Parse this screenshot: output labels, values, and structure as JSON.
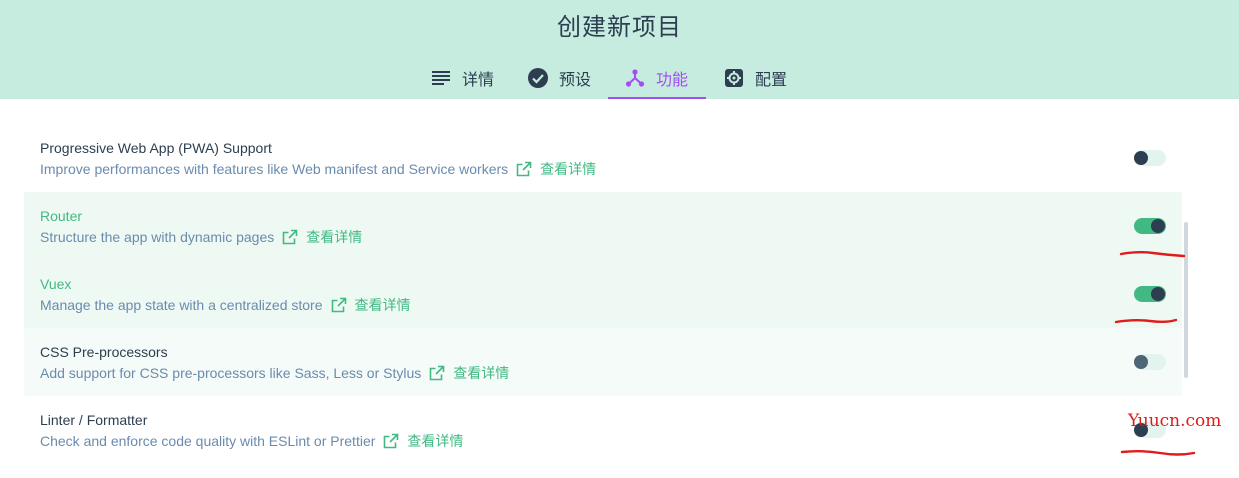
{
  "header": {
    "title": "创建新项目",
    "tabs": [
      {
        "label": "详情",
        "icon": "list-icon"
      },
      {
        "label": "预设",
        "icon": "check-circle-icon"
      },
      {
        "label": "功能",
        "icon": "fork-icon",
        "active": true
      },
      {
        "label": "配置",
        "icon": "gear-icon"
      }
    ]
  },
  "features": [
    {
      "name": "Progressive Web App (PWA) Support",
      "description": "Improve performances with features like Web manifest and Service workers",
      "more": "查看详情",
      "enabled": false
    },
    {
      "name": "Router",
      "description": "Structure the app with dynamic pages",
      "more": "查看详情",
      "enabled": true
    },
    {
      "name": "Vuex",
      "description": "Manage the app state with a centralized store",
      "more": "查看详情",
      "enabled": true
    },
    {
      "name": "CSS Pre-processors",
      "description": "Add support for CSS pre-processors like Sass, Less or Stylus",
      "more": "查看详情",
      "enabled": false
    },
    {
      "name": "Linter / Formatter",
      "description": "Check and enforce code quality with ESLint or Prettier",
      "more": "查看详情",
      "enabled": false
    }
  ],
  "watermark": "Yuucn.com",
  "colors": {
    "header_bg": "#c6ebdf",
    "accent_green": "#42b983",
    "accent_purple": "#a44cf6",
    "text": "#2c3e50",
    "muted": "#6a8bad",
    "annotation_red": "#e01b1b"
  }
}
